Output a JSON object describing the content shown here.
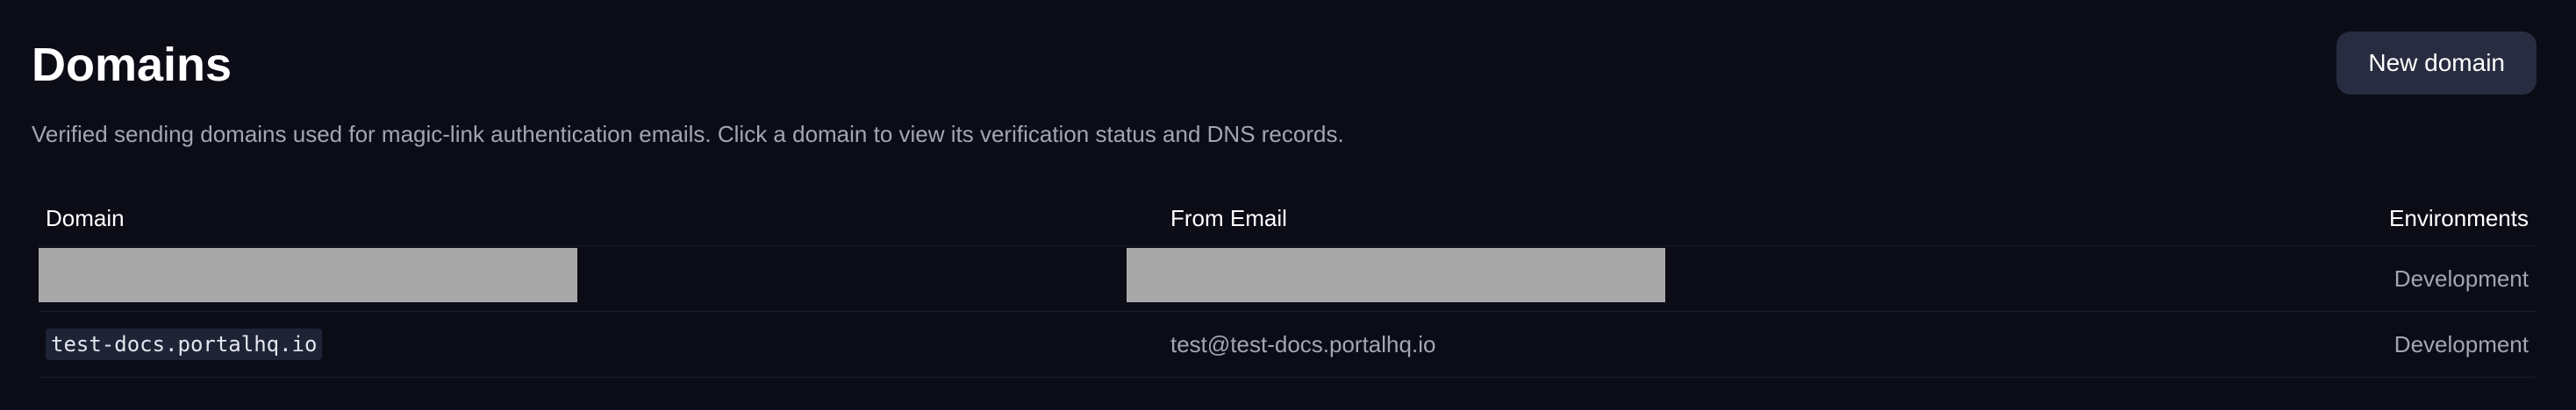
{
  "page": {
    "title": "Domains",
    "description": "Verified sending domains used for magic-link authentication emails. Click a domain to view its verification status and DNS records.",
    "new_domain_label": "New domain"
  },
  "table": {
    "columns": {
      "domain": "Domain",
      "from_email": "From Email",
      "environments": "Environments"
    },
    "rows": [
      {
        "domain": "",
        "from_email": "",
        "environments": "Development",
        "redacted": true
      },
      {
        "domain": "test-docs.portalhq.io",
        "from_email": "test@test-docs.portalhq.io",
        "environments": "Development",
        "redacted": false
      }
    ]
  },
  "colors": {
    "background": "#0b0c16",
    "button_bg": "#272c40",
    "muted_text": "#a3a6b1",
    "redaction": "#a8a8a8"
  }
}
